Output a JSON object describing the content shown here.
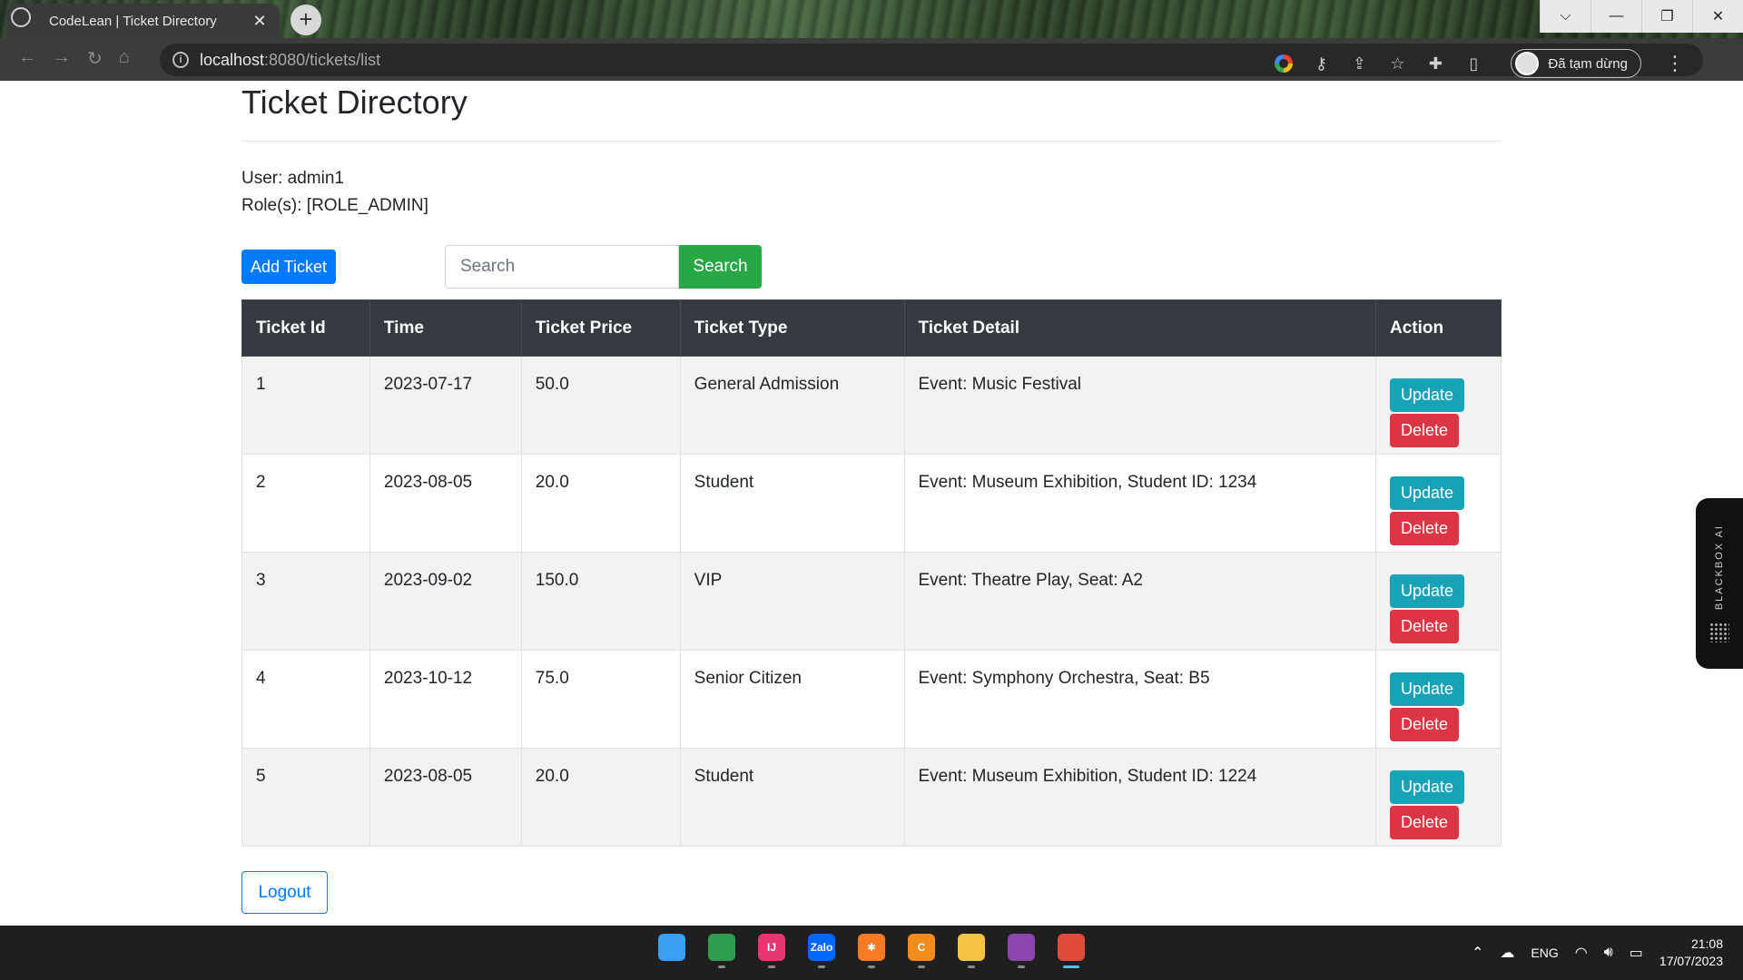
{
  "browser": {
    "tab_title": "CodeLean | Ticket Directory",
    "tab_close": "✕",
    "new_tab": "+",
    "url_host": "localhost",
    "url_path": ":8080/tickets/list",
    "profile_status": "Đã tạm dừng",
    "window_buttons": [
      "⌵",
      "—",
      "❐",
      "✕"
    ]
  },
  "page": {
    "title": "Ticket Directory",
    "user_line": "User: admin1",
    "roles_line": "Role(s): [ROLE_ADMIN]",
    "add_button": "Add Ticket",
    "search_placeholder": "Search",
    "search_button": "Search",
    "logout_button": "Logout"
  },
  "table": {
    "headers": [
      "Ticket Id",
      "Time",
      "Ticket Price",
      "Ticket Type",
      "Ticket Detail",
      "Action"
    ],
    "update_label": "Update",
    "delete_label": "Delete",
    "rows": [
      {
        "id": "1",
        "time": "2023-07-17",
        "price": "50.0",
        "type": "General Admission",
        "detail": "Event: Music Festival"
      },
      {
        "id": "2",
        "time": "2023-08-05",
        "price": "20.0",
        "type": "Student",
        "detail": "Event: Museum Exhibition, Student ID: 1234"
      },
      {
        "id": "3",
        "time": "2023-09-02",
        "price": "150.0",
        "type": "VIP",
        "detail": "Event: Theatre Play, Seat: A2"
      },
      {
        "id": "4",
        "time": "2023-10-12",
        "price": "75.0",
        "type": "Senior Citizen",
        "detail": "Event: Symphony Orchestra, Seat: B5"
      },
      {
        "id": "5",
        "time": "2023-08-05",
        "price": "20.0",
        "type": "Student",
        "detail": "Event: Museum Exhibition, Student ID: 1224"
      }
    ]
  },
  "widget": {
    "label": "BLACKBOX AI"
  },
  "taskbar": {
    "apps": [
      {
        "name": "windows-start-icon",
        "label": "",
        "color": "#3aa0f3"
      },
      {
        "name": "chrome-alt-icon",
        "label": "",
        "color": "#2e9e4f"
      },
      {
        "name": "intellij-icon",
        "label": "IJ",
        "color": "#e6356f"
      },
      {
        "name": "zalo-icon",
        "label": "Zalo",
        "color": "#0068ff"
      },
      {
        "name": "xampp-icon",
        "label": "✱",
        "color": "#fb7a24"
      },
      {
        "name": "coccoc-icon",
        "label": "C",
        "color": "#f28c1c"
      },
      {
        "name": "file-explorer-icon",
        "label": "",
        "color": "#f6c244"
      },
      {
        "name": "github-desktop-icon",
        "label": "",
        "color": "#8e44ad"
      },
      {
        "name": "chrome-icon",
        "label": "",
        "color": "#e04b3a"
      }
    ],
    "language": "ENG",
    "time": "21:08",
    "date": "17/07/2023"
  }
}
